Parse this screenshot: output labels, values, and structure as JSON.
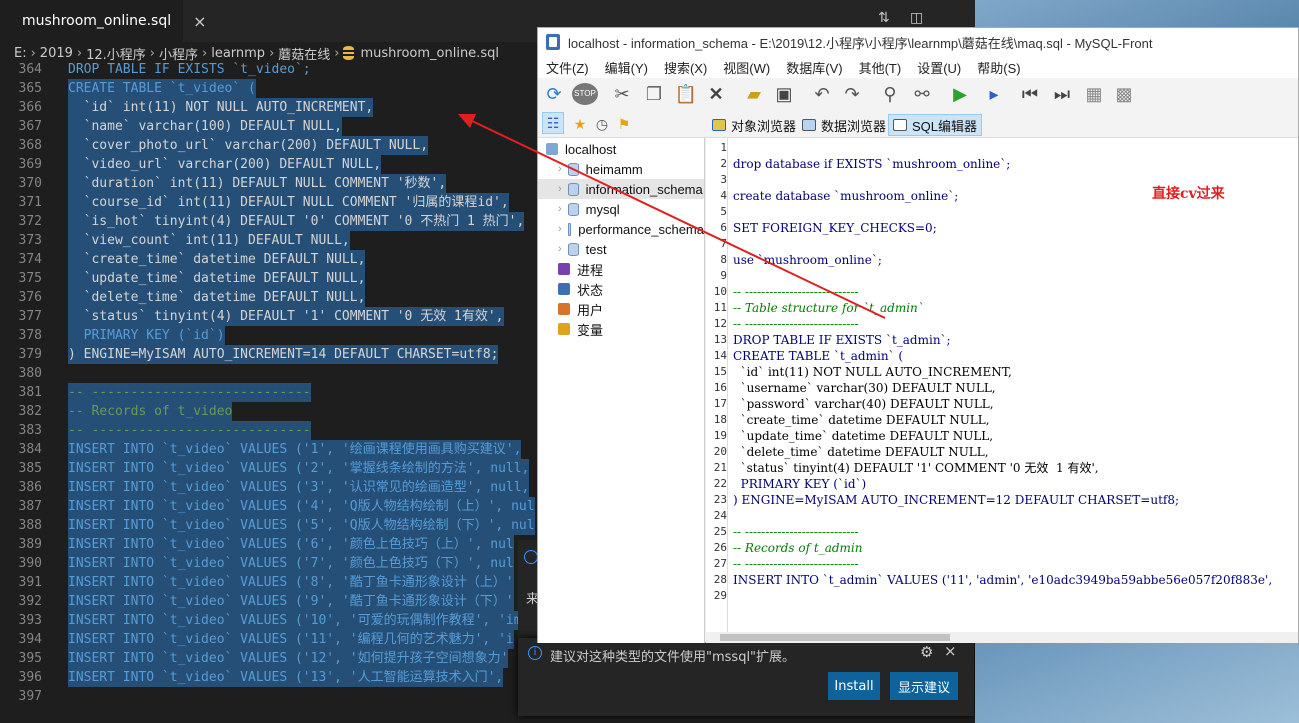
{
  "vscode": {
    "tab_title": "mushroom_online.sql",
    "breadcrumb": [
      "E:",
      "2019",
      "12.小程序",
      "小程序",
      "learnmp",
      "蘑菇在线",
      "mushroom_online.sql"
    ],
    "lines": [
      {
        "n": "364",
        "t": "DROP TABLE IF EXISTS `t_video`;"
      },
      {
        "n": "365",
        "t": "CREATE TABLE `t_video` ("
      },
      {
        "n": "366",
        "t": "  `id` int(11) NOT NULL AUTO_INCREMENT,"
      },
      {
        "n": "367",
        "t": "  `name` varchar(100) DEFAULT NULL,"
      },
      {
        "n": "368",
        "t": "  `cover_photo_url` varchar(200) DEFAULT NULL,"
      },
      {
        "n": "369",
        "t": "  `video_url` varchar(200) DEFAULT NULL,"
      },
      {
        "n": "370",
        "t": "  `duration` int(11) DEFAULT NULL COMMENT '秒数',"
      },
      {
        "n": "371",
        "t": "  `course_id` int(11) DEFAULT NULL COMMENT '归属的课程id',"
      },
      {
        "n": "372",
        "t": "  `is_hot` tinyint(4) DEFAULT '0' COMMENT '0 不热门 1 热门',"
      },
      {
        "n": "373",
        "t": "  `view_count` int(11) DEFAULT NULL,"
      },
      {
        "n": "374",
        "t": "  `create_time` datetime DEFAULT NULL,"
      },
      {
        "n": "375",
        "t": "  `update_time` datetime DEFAULT NULL,"
      },
      {
        "n": "376",
        "t": "  `delete_time` datetime DEFAULT NULL,"
      },
      {
        "n": "377",
        "t": "  `status` tinyint(4) DEFAULT '1' COMMENT '0 无效 1有效',"
      },
      {
        "n": "378",
        "t": "  PRIMARY KEY (`id`)"
      },
      {
        "n": "379",
        "t": ") ENGINE=MyISAM AUTO_INCREMENT=14 DEFAULT CHARSET=utf8;"
      },
      {
        "n": "380",
        "t": ""
      },
      {
        "n": "381",
        "t": "-- ----------------------------"
      },
      {
        "n": "382",
        "t": "-- Records of t_video"
      },
      {
        "n": "383",
        "t": "-- ----------------------------"
      },
      {
        "n": "384",
        "t": "INSERT INTO `t_video` VALUES ('1', '绘画课程使用画具购买建议',"
      },
      {
        "n": "385",
        "t": "INSERT INTO `t_video` VALUES ('2', '掌握线条绘制的方法', null,"
      },
      {
        "n": "386",
        "t": "INSERT INTO `t_video` VALUES ('3', '认识常见的绘画造型', null,"
      },
      {
        "n": "387",
        "t": "INSERT INTO `t_video` VALUES ('4', 'Q版人物结构绘制（上）', nul"
      },
      {
        "n": "388",
        "t": "INSERT INTO `t_video` VALUES ('5', 'Q版人物结构绘制（下）', nul"
      },
      {
        "n": "389",
        "t": "INSERT INTO `t_video` VALUES ('6', '颜色上色技巧（上）', nul"
      },
      {
        "n": "390",
        "t": "INSERT INTO `t_video` VALUES ('7', '颜色上色技巧（下）', nul"
      },
      {
        "n": "391",
        "t": "INSERT INTO `t_video` VALUES ('8', '酷丁鱼卡通形象设计（上）'"
      },
      {
        "n": "392",
        "t": "INSERT INTO `t_video` VALUES ('9', '酷丁鱼卡通形象设计（下）'"
      },
      {
        "n": "393",
        "t": "INSERT INTO `t_video` VALUES ('10', '可爱的玩偶制作教程', 'imag"
      },
      {
        "n": "394",
        "t": "INSERT INTO `t_video` VALUES ('11', '编程几何的艺术魅力', 'i"
      },
      {
        "n": "395",
        "t": "INSERT INTO `t_video` VALUES ('12', '如何提升孩子空间想象力'"
      },
      {
        "n": "396",
        "t": "INSERT INTO `t_video` VALUES ('13', '人工智能运算技术入门',"
      },
      {
        "n": "397",
        "t": ""
      }
    ],
    "notification": {
      "message": "建议对这种类型的文件使用\"mssql\"扩展。",
      "install_label": "Install",
      "show_label": "显示建议",
      "partial_char": "来"
    }
  },
  "mysqlfront": {
    "title": "localhost - information_schema - E:\\2019\\12.小程序\\小程序\\learnmp\\蘑菇在线\\maq.sql - MySQL-Front",
    "menu": [
      "文件(Z)",
      "编辑(Y)",
      "搜索(X)",
      "视图(W)",
      "数据库(V)",
      "其他(T)",
      "设置(U)",
      "帮助(S)"
    ],
    "tabs": [
      "对象浏览器",
      "数据浏览器",
      "SQL编辑器"
    ],
    "tree": [
      "localhost",
      "heimamm",
      "information_schema",
      "mysql",
      "performance_schema",
      "test",
      "进程",
      "状态",
      "用户",
      "变量"
    ],
    "annotation": "直接cv过来",
    "lines": [
      {
        "n": "1",
        "t": ""
      },
      {
        "n": "2",
        "t": "drop database if EXISTS `mushroom_online`;"
      },
      {
        "n": "3",
        "t": ""
      },
      {
        "n": "4",
        "t": "create database `mushroom_online`;"
      },
      {
        "n": "5",
        "t": ""
      },
      {
        "n": "6",
        "t": "SET FOREIGN_KEY_CHECKS=0;"
      },
      {
        "n": "7",
        "t": ""
      },
      {
        "n": "8",
        "t": "use `mushroom_online`;"
      },
      {
        "n": "9",
        "t": ""
      },
      {
        "n": "10",
        "t": "-- ----------------------------"
      },
      {
        "n": "11",
        "t": "-- Table structure for `t_admin`"
      },
      {
        "n": "12",
        "t": "-- ----------------------------"
      },
      {
        "n": "13",
        "t": "DROP TABLE IF EXISTS `t_admin`;"
      },
      {
        "n": "14",
        "t": "CREATE TABLE `t_admin` ("
      },
      {
        "n": "15",
        "t": "  `id` int(11) NOT NULL AUTO_INCREMENT,"
      },
      {
        "n": "16",
        "t": "  `username` varchar(30) DEFAULT NULL,"
      },
      {
        "n": "17",
        "t": "  `password` varchar(40) DEFAULT NULL,"
      },
      {
        "n": "18",
        "t": "  `create_time` datetime DEFAULT NULL,"
      },
      {
        "n": "19",
        "t": "  `update_time` datetime DEFAULT NULL,"
      },
      {
        "n": "20",
        "t": "  `delete_time` datetime DEFAULT NULL,"
      },
      {
        "n": "21",
        "t": "  `status` tinyint(4) DEFAULT '1' COMMENT '0 无效  1 有效',"
      },
      {
        "n": "22",
        "t": "  PRIMARY KEY (`id`)"
      },
      {
        "n": "23",
        "t": ") ENGINE=MyISAM AUTO_INCREMENT=12 DEFAULT CHARSET=utf8;"
      },
      {
        "n": "24",
        "t": ""
      },
      {
        "n": "25",
        "t": "-- ----------------------------"
      },
      {
        "n": "26",
        "t": "-- Records of t_admin"
      },
      {
        "n": "27",
        "t": "-- ----------------------------"
      },
      {
        "n": "28",
        "t": "INSERT INTO `t_admin` VALUES ('11', 'admin', 'e10adc3949ba59abbe56e057f20f883e',"
      },
      {
        "n": "29",
        "t": ""
      }
    ]
  },
  "colors": {
    "arrow": "#e02020",
    "vscode_bg": "#1e1e1e",
    "selection": "#264f78"
  }
}
